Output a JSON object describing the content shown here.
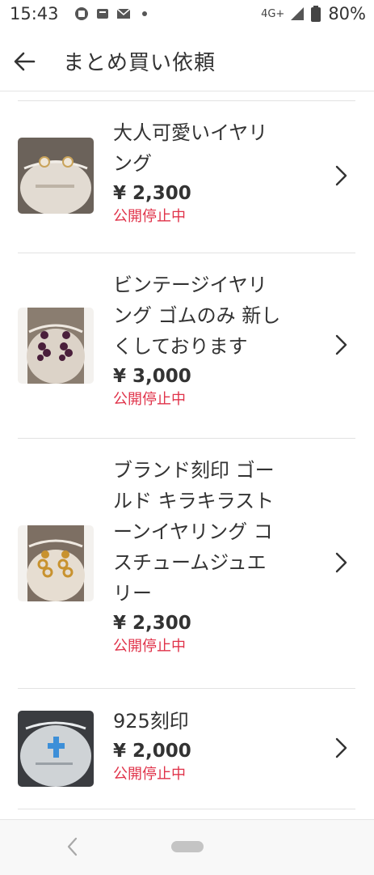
{
  "status_bar": {
    "time": "15:43",
    "network_label": "4G+",
    "battery": "80%",
    "icons": [
      "sim-icon",
      "app-notification-icon",
      "mail-icon",
      "dot-icon",
      "signal-icon",
      "battery-icon"
    ]
  },
  "header": {
    "title": "まとめ買い依頼",
    "back_icon": "back-arrow-icon"
  },
  "items": [
    {
      "name_lines": [
        "大人可愛いイヤリ",
        "ング"
      ],
      "price": "¥ 2,300",
      "status": "公開停止中"
    },
    {
      "name_lines": [
        "ビンテージイヤリ",
        "ング ゴムのみ 新し",
        "くしております"
      ],
      "price": "¥ 3,000",
      "status": "公開停止中"
    },
    {
      "name_lines": [
        "ブランド刻印 ゴー",
        "ルド キラキラスト",
        "ーンイヤリング コ",
        "スチュームジュエ",
        "リー"
      ],
      "price": "¥ 2,300",
      "status": "公開停止中"
    },
    {
      "name_lines": [
        "925刻印"
      ],
      "price": "¥ 2,000",
      "status": "公開停止中"
    }
  ],
  "colors": {
    "status_red": "#e0334a",
    "text": "#333333",
    "divider": "#e2e2e2"
  },
  "nav": {
    "back_icon": "nav-back-icon",
    "home_icon": "home-pill-icon"
  }
}
